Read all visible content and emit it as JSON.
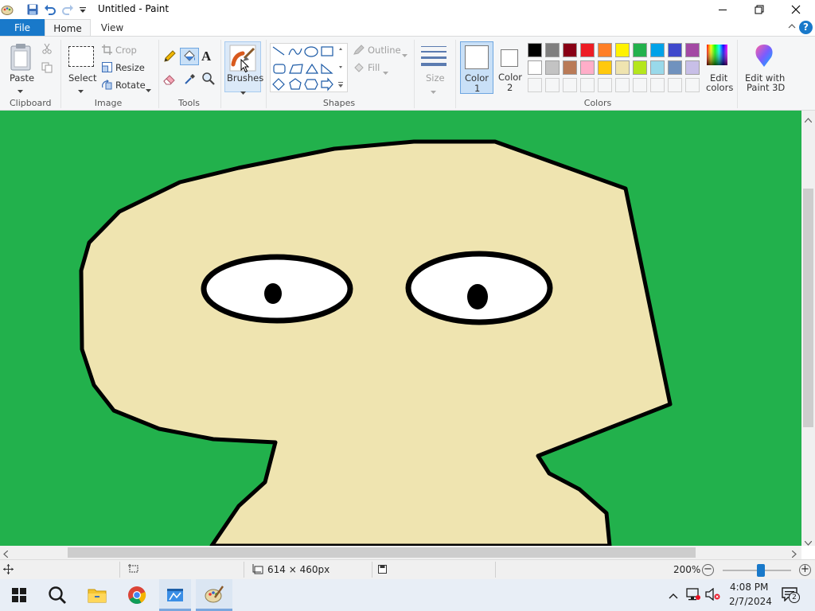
{
  "window": {
    "title": "Untitled - Paint"
  },
  "tabs": {
    "file": "File",
    "home": "Home",
    "view": "View"
  },
  "ribbon": {
    "clipboard": {
      "paste": "Paste",
      "group": "Clipboard"
    },
    "image": {
      "select": "Select",
      "crop": "Crop",
      "resize": "Resize",
      "rotate": "Rotate",
      "group": "Image"
    },
    "tools": {
      "group": "Tools"
    },
    "brushes": {
      "label": "Brushes"
    },
    "shapes": {
      "outline": "Outline",
      "fill": "Fill",
      "group": "Shapes"
    },
    "size": {
      "label": "Size"
    },
    "colors": {
      "color1": "Color\n1",
      "color1_line1": "Color",
      "color1_line2": "1",
      "color2_line1": "Color",
      "color2_line2": "2",
      "edit_line1": "Edit",
      "edit_line2": "colors",
      "group": "Colors",
      "palette_row1": [
        "#000000",
        "#7f7f7f",
        "#880015",
        "#ed1c24",
        "#ff7f27",
        "#fff200",
        "#22b14c",
        "#00a2e8",
        "#3f48cc",
        "#a349a4"
      ],
      "palette_row2": [
        "#ffffff",
        "#c3c3c3",
        "#b97a57",
        "#ffaec9",
        "#ffc90e",
        "#efe4b0",
        "#b5e61d",
        "#99d9ea",
        "#7092be",
        "#c8bfe7"
      ]
    },
    "paint3d": {
      "line1": "Edit with",
      "line2": "Paint 3D"
    }
  },
  "canvas": {
    "background_color": "#22b14c",
    "skin_color": "#efe4b0"
  },
  "status": {
    "dimensions": "614 × 460px",
    "zoom": "200%"
  },
  "taskbar": {
    "time": "4:08 PM",
    "date": "2/7/2024",
    "notifications": "2"
  }
}
